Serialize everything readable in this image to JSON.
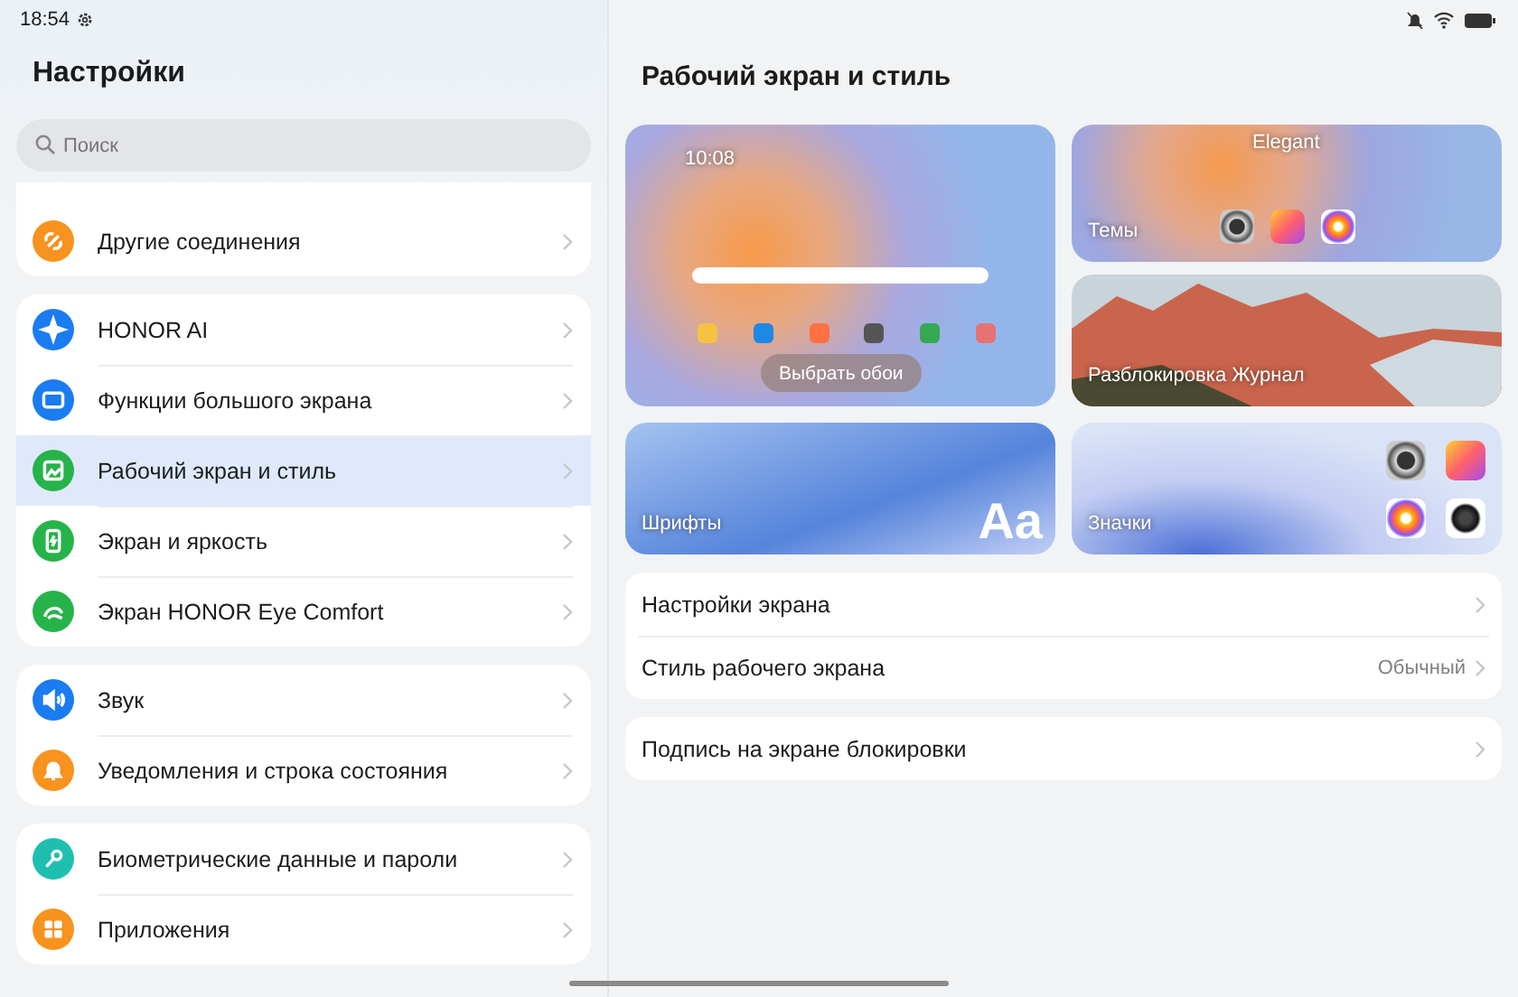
{
  "status_bar": {
    "time": "18:54"
  },
  "sidebar": {
    "title": "Настройки",
    "search": {
      "placeholder": "Поиск"
    },
    "groups": [
      {
        "items": [
          {
            "label": "Другие соединения",
            "color": "#f7931e",
            "selected": false
          }
        ]
      },
      {
        "items": [
          {
            "label": "HONOR AI",
            "color": "#1a7cf0",
            "selected": false
          },
          {
            "label": "Функции большого экрана",
            "color": "#1a7cf0",
            "selected": false
          },
          {
            "label": "Рабочий экран и стиль",
            "color": "#26b34a",
            "selected": true
          },
          {
            "label": "Экран и яркость",
            "color": "#26b34a",
            "selected": false
          },
          {
            "label": "Экран HONOR Eye Comfort",
            "color": "#26b34a",
            "selected": false
          }
        ]
      },
      {
        "items": [
          {
            "label": "Звук",
            "color": "#1a7cf0",
            "selected": false
          },
          {
            "label": "Уведомления и строка состояния",
            "color": "#f7931e",
            "selected": false
          }
        ]
      },
      {
        "items": [
          {
            "label": "Биометрические данные и пароли",
            "color": "#1fbfb0",
            "selected": false
          },
          {
            "label": "Приложения",
            "color": "#f7931e",
            "selected": false
          }
        ]
      }
    ]
  },
  "main": {
    "title": "Рабочий экран и стиль",
    "wallpaper": {
      "clock": "10:08",
      "button": "Выбрать обои"
    },
    "themes": {
      "theme_name": "Elegant",
      "label": "Темы"
    },
    "magazine": {
      "label": "Разблокировка Журнал"
    },
    "fonts": {
      "label": "Шрифты",
      "sample": "Aa"
    },
    "icons": {
      "label": "Значки"
    },
    "settings_groups": [
      {
        "rows": [
          {
            "label": "Настройки экрана"
          },
          {
            "label": "Стиль рабочего экрана",
            "value": "Обычный"
          }
        ]
      },
      {
        "rows": [
          {
            "label": "Подпись на экране блокировки"
          }
        ]
      }
    ]
  }
}
